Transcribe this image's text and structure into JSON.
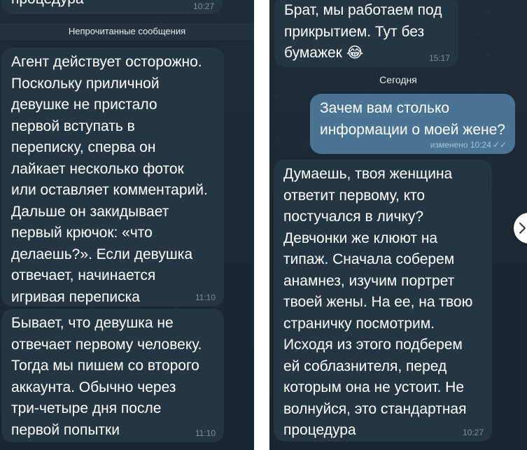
{
  "left_panel": {
    "top_message": {
      "text": "процедура",
      "time": "10:27"
    },
    "unread_divider": "Непрочитанные сообщения",
    "messages": [
      {
        "text": "Агент действует осторожно.\nПоскольку приличной\nдевушке не пристало\nпервой вступать в\nпереписку, сперва он\nлайкает несколько фоток\nили оставляет комментарий.\nДальше он закидывает\nпервый крючок: «что\nделаешь?». Если девушка\nотвечает, начинается\nигривая переписка",
        "time": "11:10"
      },
      {
        "text": "Бывает, что девушка не\nотвечает первому человеку.\nТогда мы пишем со второго\nаккаунта. Обычно через\nтри-четыре дня после\nпервой попытки",
        "time": "11:10"
      }
    ]
  },
  "right_panel": {
    "top_message": {
      "text": "Брат, мы работаем под\nприкрытием. Тут без\nбумажек 😂",
      "time": "15:17"
    },
    "date_divider": "Сегодня",
    "outgoing_message": {
      "text": "Зачем вам столько\nинформации о моей жене?",
      "time": "изменено 10:24",
      "status_icon": "double-check"
    },
    "reply_message": {
      "text": "Думаешь, твоя женщина\nответит первому, кто\nпостучался в личку?\nДевчонки же клюют на\nтипаж. Сначала соберем\nанамнез, изучим портрет\nтвоей жены. На ее, на твою\nстраничку посмотрим.\nИсходя из этого подберем\nей соблазнителя, перед\nкоторым она не устоит. Не\nволнуйся, это стандартная\nпроцедура",
      "time": "10:27"
    }
  },
  "colors": {
    "chat_background": "#1b2a35",
    "incoming_bubble": "#243642",
    "outgoing_bubble": "#4a7494",
    "timestamp": "#7f909b"
  },
  "icons": [
    "double-check-icon",
    "chevron-right-icon"
  ]
}
